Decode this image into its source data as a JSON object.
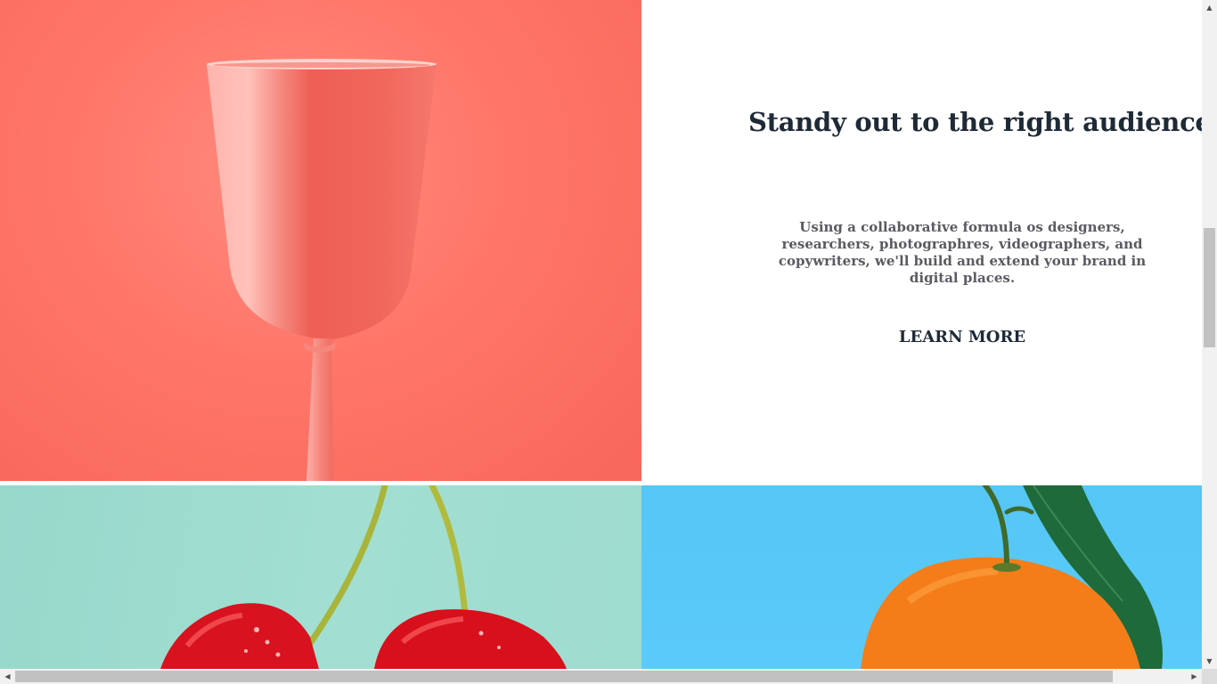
{
  "feature": {
    "headline": "Standy out to the right audience",
    "body": "Using a collaborative formula os designers, researchers, photographres, videographers, and copywriters, we'll build and extend your brand in digital places.",
    "cta_label": "LEARN MORE"
  },
  "tiles": [
    {
      "name": "glass-image",
      "subject": "pink wine glass",
      "background": "#ff7668"
    },
    {
      "name": "cherry-image",
      "subject": "red cherries",
      "background": "#a2ded2"
    },
    {
      "name": "orange-image",
      "subject": "orange with leaves",
      "background": "#5bcaf8"
    }
  ],
  "colors": {
    "heading": "#1f2a37",
    "body_text": "#5a5a62",
    "scrollbar_track": "#f1f1f1",
    "scrollbar_thumb": "#c1c1c1"
  },
  "icons": {
    "scroll_up": "▲",
    "scroll_down": "▼",
    "scroll_left": "◀",
    "scroll_right": "▶"
  }
}
